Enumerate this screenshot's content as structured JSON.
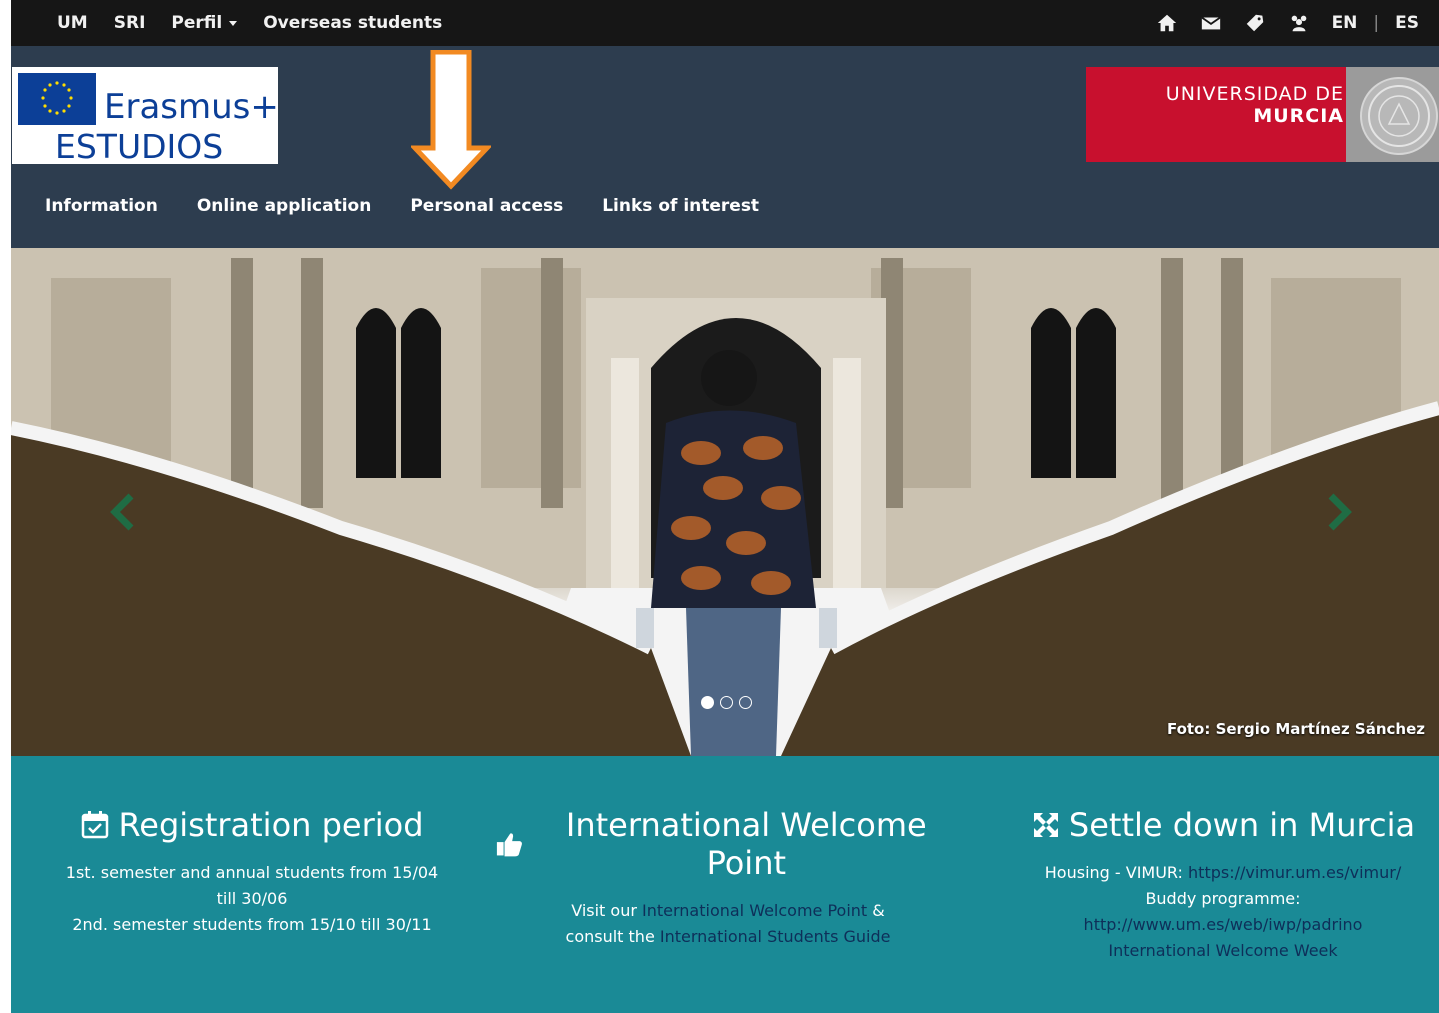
{
  "topbar": {
    "links": [
      "UM",
      "SRI",
      "Perfil",
      "Overseas students"
    ],
    "icons": [
      "home-icon",
      "envelope-icon",
      "tag-icon",
      "users-icon"
    ],
    "lang_en": "EN",
    "lang_sep": "|",
    "lang_es": "ES"
  },
  "header": {
    "logo_erasmus": "Erasmus+",
    "logo_estudios": "ESTUDIOS",
    "um_line1": "UNIVERSIDAD DE",
    "um_line2": "MURCIA"
  },
  "mainnav": {
    "items": [
      "Information",
      "Online application",
      "Personal access",
      "Links of interest"
    ]
  },
  "carousel": {
    "credit": "Foto: Sergio Martínez Sánchez",
    "slide_count": 3,
    "active_slide": 1
  },
  "columns": {
    "registration": {
      "title": "Registration period",
      "line1": "1st. semester and annual students from 15/04",
      "line2": "till 30/06",
      "line3": "2nd. semester students from 15/10 till 30/11"
    },
    "welcome": {
      "title": "International Welcome Point",
      "pre1": "Visit our ",
      "link1": "International Welcome Point",
      "post1": " &",
      "pre2": "consult the ",
      "link2": "International Students Guide"
    },
    "settle": {
      "title": "Settle down in Murcia",
      "housing_label": "Housing - VIMUR: ",
      "housing_link": "https://vimur.um.es/vimur/",
      "buddy_label": "Buddy programme:",
      "buddy_link": "http://www.um.es/web/iwp/padrino",
      "week_link": "International Welcome Week"
    }
  },
  "colors": {
    "topbar": "#161616",
    "header": "#2d3d4f",
    "band": "#1a8a96",
    "um_red": "#c8102e",
    "arrow": "#f28a22"
  }
}
